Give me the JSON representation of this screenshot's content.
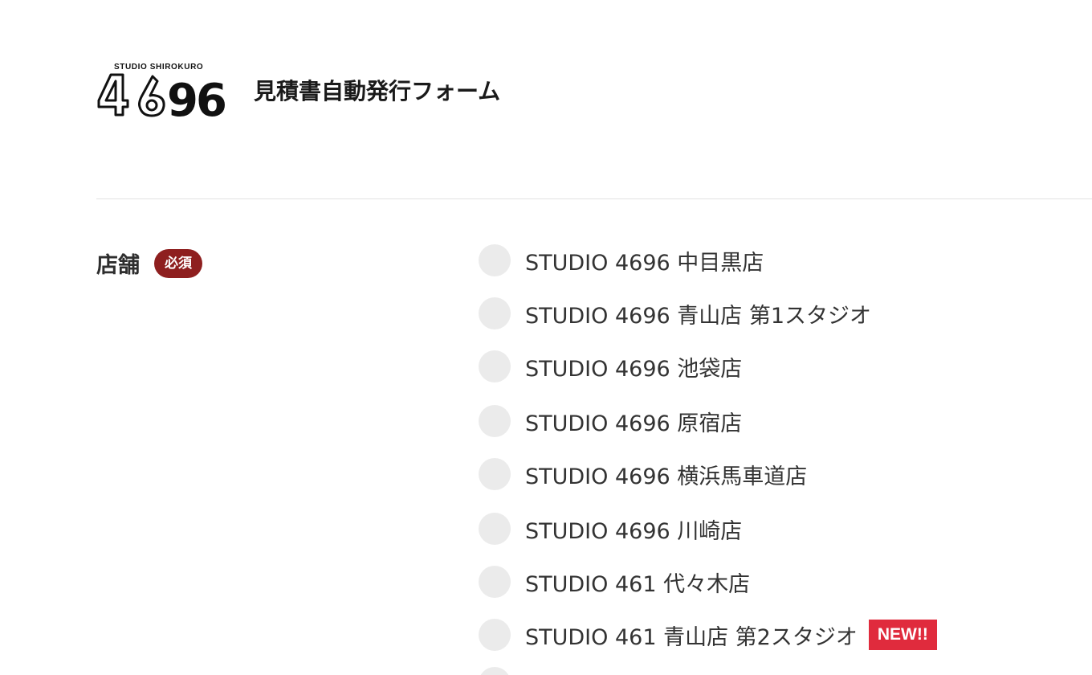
{
  "header": {
    "logo_sub": "STUDIO SHIROKURO",
    "logo_main": "4696",
    "title": "見積書自動発行フォーム"
  },
  "field": {
    "label": "店舗",
    "required_badge": "必須"
  },
  "options": [
    {
      "label": "STUDIO 4696 中目黒店",
      "selected": false
    },
    {
      "label": "STUDIO 4696 青山店 第1スタジオ",
      "selected": false
    },
    {
      "label": "STUDIO 4696 池袋店",
      "selected": false
    },
    {
      "label": "STUDIO 4696 原宿店",
      "selected": false
    },
    {
      "label": "STUDIO 4696 横浜馬車道店",
      "selected": false
    },
    {
      "label": "STUDIO 4696 川崎店",
      "selected": false
    },
    {
      "label": "STUDIO 461 代々木店",
      "selected": false
    },
    {
      "label": "STUDIO 461 青山店 第2スタジオ",
      "selected": false,
      "badge": "NEW!!"
    }
  ],
  "colors": {
    "required_badge_bg": "#8e1f1f",
    "new_badge_bg": "#e02b3d",
    "radio_bg": "#ebebeb",
    "divider": "#e3e3e3"
  }
}
